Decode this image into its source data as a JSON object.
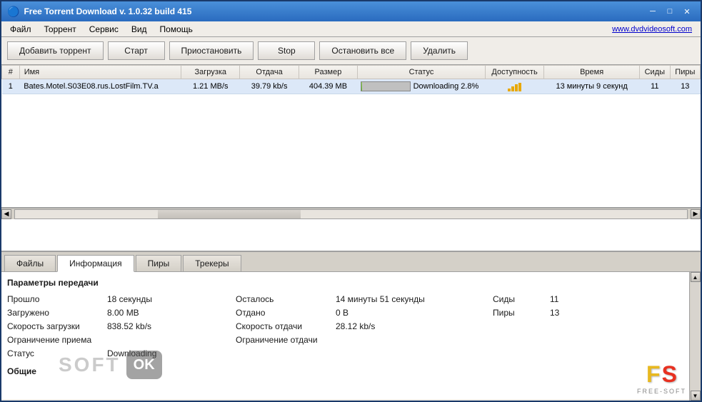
{
  "titleBar": {
    "title": "Free Torrent Download v. 1.0.32 build 415",
    "icon": "🔵"
  },
  "windowControls": {
    "minimize": "─",
    "maximize": "□",
    "close": "✕"
  },
  "menuBar": {
    "items": [
      "Файл",
      "Торрент",
      "Сервис",
      "Вид",
      "Помощь"
    ],
    "dvdLink": "www.dvdvideosoft.com"
  },
  "toolbar": {
    "addTorrent": "Добавить торрент",
    "start": "Старт",
    "pause": "Приостановить",
    "stop": "Stop",
    "stopAll": "Остановить все",
    "delete": "Удалить"
  },
  "table": {
    "columns": [
      "#",
      "Имя",
      "Загрузка",
      "Отдача",
      "Размер",
      "Статус",
      "Доступность",
      "Время",
      "Сиды",
      "Пиры"
    ],
    "rows": [
      {
        "num": "1",
        "name": "Bates.Motel.S03E08.rus.LostFilm.TV.a",
        "download": "1.21 MB/s",
        "upload": "39.79 kb/s",
        "size": "404.39 MB",
        "status": "Downloading 2.8%",
        "progress": 2.8,
        "availability": "▊▊▊",
        "time": "13 минуты 9 секунд",
        "seeds": "11",
        "peers": "13"
      }
    ]
  },
  "tabs": {
    "items": [
      "Файлы",
      "Информация",
      "Пиры",
      "Трекеры"
    ],
    "active": 1
  },
  "infoPanel": {
    "sectionTitle": "Параметры передачи",
    "rows": [
      {
        "label1": "Прошло",
        "value1": "18 секунды",
        "label2": "Осталось",
        "value2": "14 минуты 51 секунды",
        "label3": "Сиды",
        "value3": "11"
      },
      {
        "label1": "Загружено",
        "value1": "8.00 MB",
        "label2": "Отдано",
        "value2": "0 В",
        "label3": "Пиры",
        "value3": "13"
      },
      {
        "label1": "Скорость загрузки",
        "value1": "838.52 kb/s",
        "label2": "Скорость отдачи",
        "value2": "28.12 kb/s",
        "label3": "",
        "value3": ""
      },
      {
        "label1": "Ограничение приема",
        "value1": "",
        "label2": "Ограничение отдачи",
        "value2": "",
        "label3": "",
        "value3": ""
      },
      {
        "label1": "Статус",
        "value1": "Downloading",
        "label2": "",
        "value2": "",
        "label3": "",
        "value3": ""
      }
    ],
    "generalLabel": "Общие"
  },
  "watermark": {
    "soft": "SOFT",
    "ok": "OK"
  },
  "fsLogo": {
    "f": "F",
    "s": "S",
    "subtitle": "FREE-SOFT"
  }
}
